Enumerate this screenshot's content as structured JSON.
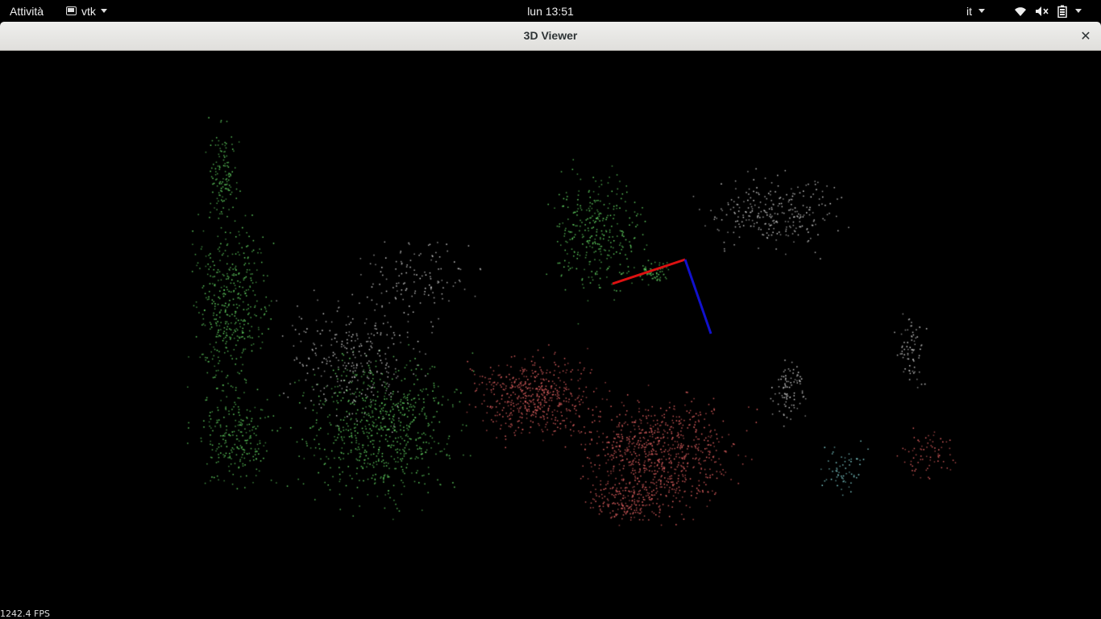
{
  "topbar": {
    "activities_label": "Attività",
    "app_name": "vtk",
    "clock": "lun 13:51",
    "keyboard_layout": "it",
    "icons": [
      "window-app-icon",
      "wifi-icon",
      "volume-muted-icon",
      "battery-icon"
    ]
  },
  "window": {
    "title": "3D Viewer",
    "close_glyph": "✕"
  },
  "viewer": {
    "fps_label": "1242.4 FPS",
    "background": "#000000",
    "axes": {
      "x_color": "#dd1111",
      "z_color": "#1111cc"
    },
    "point_colors": {
      "green": "#66dd66",
      "red": "#ee6666",
      "white": "#dddddd",
      "cyan": "#88dddd"
    }
  }
}
